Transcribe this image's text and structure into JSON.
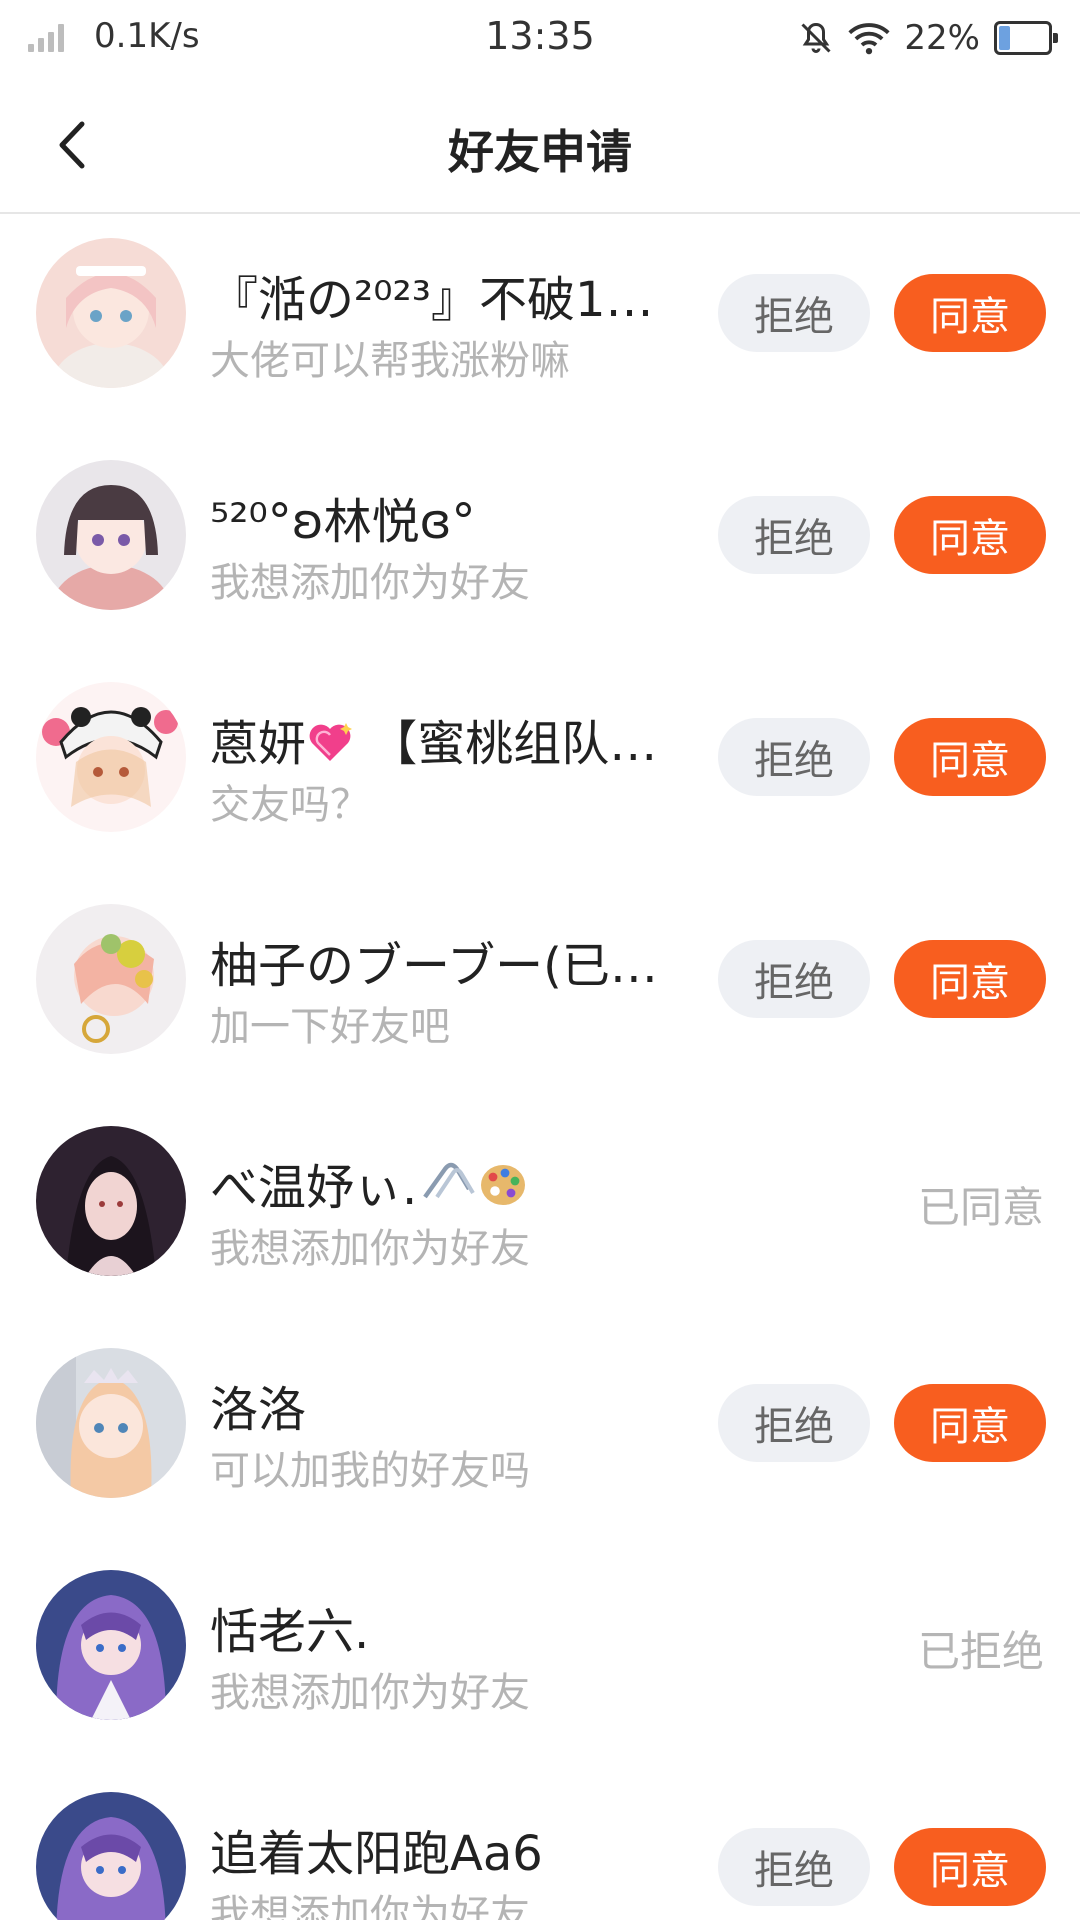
{
  "status_bar": {
    "network_speed": "0.1K/s",
    "time": "13:35",
    "battery_percent": "22%",
    "battery_level": 0.22,
    "icons": [
      "signal-icon",
      "mute-bell-icon",
      "wifi-icon",
      "battery-icon"
    ]
  },
  "header": {
    "title": "好友申请",
    "back_icon": "chevron-left-icon"
  },
  "colors": {
    "accept": "#f85e1f",
    "reject_bg": "#eef0f4",
    "muted_text": "#b4b4b4"
  },
  "requests": [
    {
      "name": "『湉の²⁰²³』不破1…",
      "message": "大佬可以帮我涨粉嘛",
      "state": "pending",
      "reject_label": "拒绝",
      "accept_label": "同意",
      "status_label": ""
    },
    {
      "name": "⁵²⁰°ʚ林悦ɞ°",
      "message": "我想添加你为好友",
      "state": "pending",
      "reject_label": "拒绝",
      "accept_label": "同意",
      "status_label": ""
    },
    {
      "name": "蒽妍",
      "name_emoji": "sparkling-heart-icon",
      "name_suffix": "【蜜桃组队…",
      "message": "交友吗？",
      "state": "pending",
      "reject_label": "拒绝",
      "accept_label": "同意",
      "status_label": ""
    },
    {
      "name": "柚子のブーブー(已…",
      "message": "加一下好友吧",
      "state": "pending",
      "reject_label": "拒绝",
      "accept_label": "同意",
      "status_label": ""
    },
    {
      "name": "べ温妤ぃ.",
      "name_emoji": "paperclip-palette-icon",
      "message": "我想添加你为好友",
      "state": "accepted",
      "reject_label": "",
      "accept_label": "",
      "status_label": "已同意"
    },
    {
      "name": "洛洛",
      "message": "可以加我的好友吗",
      "state": "pending",
      "reject_label": "拒绝",
      "accept_label": "同意",
      "status_label": ""
    },
    {
      "name": "恬老六.",
      "message": "我想添加你为好友",
      "state": "rejected",
      "reject_label": "",
      "accept_label": "",
      "status_label": "已拒绝"
    },
    {
      "name": "追着太阳跑Aa6",
      "message": "我想添加你为好友",
      "state": "pending",
      "reject_label": "拒绝",
      "accept_label": "同意",
      "status_label": ""
    }
  ]
}
